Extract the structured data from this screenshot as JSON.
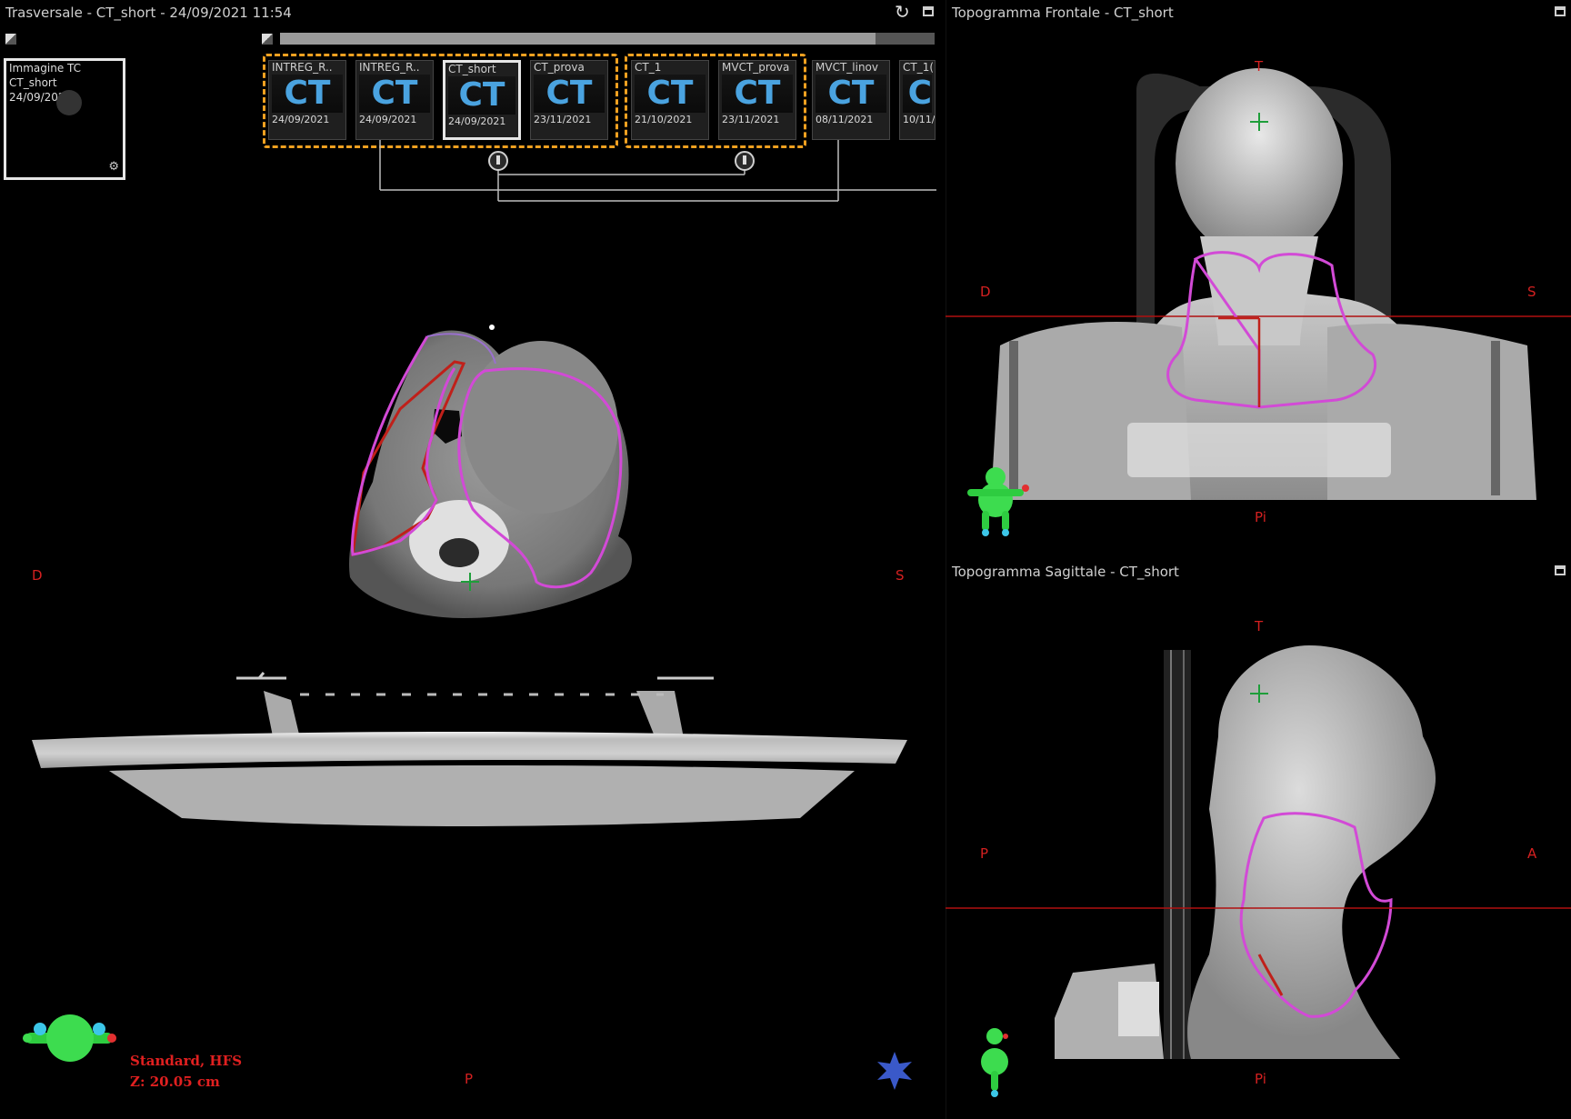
{
  "transverse": {
    "title": "Trasversale - CT_short - 24/09/2021 11:54",
    "source_thumb": {
      "line1": "Immagine TC",
      "line2": "CT_short",
      "line3": "24/09/2021"
    },
    "series": [
      {
        "name": "INTREG_R..",
        "label": "CT",
        "date": "24/09/2021"
      },
      {
        "name": "INTREG_R..",
        "label": "CT",
        "date": "24/09/2021"
      },
      {
        "name": "CT_short",
        "label": "CT",
        "date": "24/09/2021"
      },
      {
        "name": "CT_prova",
        "label": "CT",
        "date": "23/11/2021"
      },
      {
        "name": "CT_1",
        "label": "CT",
        "date": "21/10/2021"
      },
      {
        "name": "MVCT_prova",
        "label": "CT",
        "date": "23/11/2021"
      },
      {
        "name": "MVCT_linov",
        "label": "CT",
        "date": "08/11/2021"
      },
      {
        "name": "CT_1(",
        "label": "C",
        "date": "10/11/"
      }
    ],
    "orient": {
      "right": "D",
      "left": "S",
      "bottom": "P"
    },
    "status": {
      "line1": "Standard, HFS",
      "line2": "Z:  20.05 cm"
    }
  },
  "frontal": {
    "title": "Topogramma Frontale - CT_short",
    "orient": {
      "top": "T",
      "right": "D",
      "left": "S",
      "bottom": "Pi"
    }
  },
  "sagittal": {
    "title": "Topogramma Sagittale - CT_short",
    "orient": {
      "top": "T",
      "posterior": "P",
      "anterior": "A",
      "bottom": "Pi"
    }
  },
  "colors": {
    "contour_magenta": "#d24ad6",
    "contour_red": "#c0201a",
    "crosshair": "#1e9e3a",
    "group_border": "#f0a020",
    "ct_text": "#4aa3e0"
  },
  "icons": [
    "refresh-icon",
    "maximize-icon",
    "patient-orientation-icon",
    "star-icon",
    "crosshair-icon"
  ]
}
